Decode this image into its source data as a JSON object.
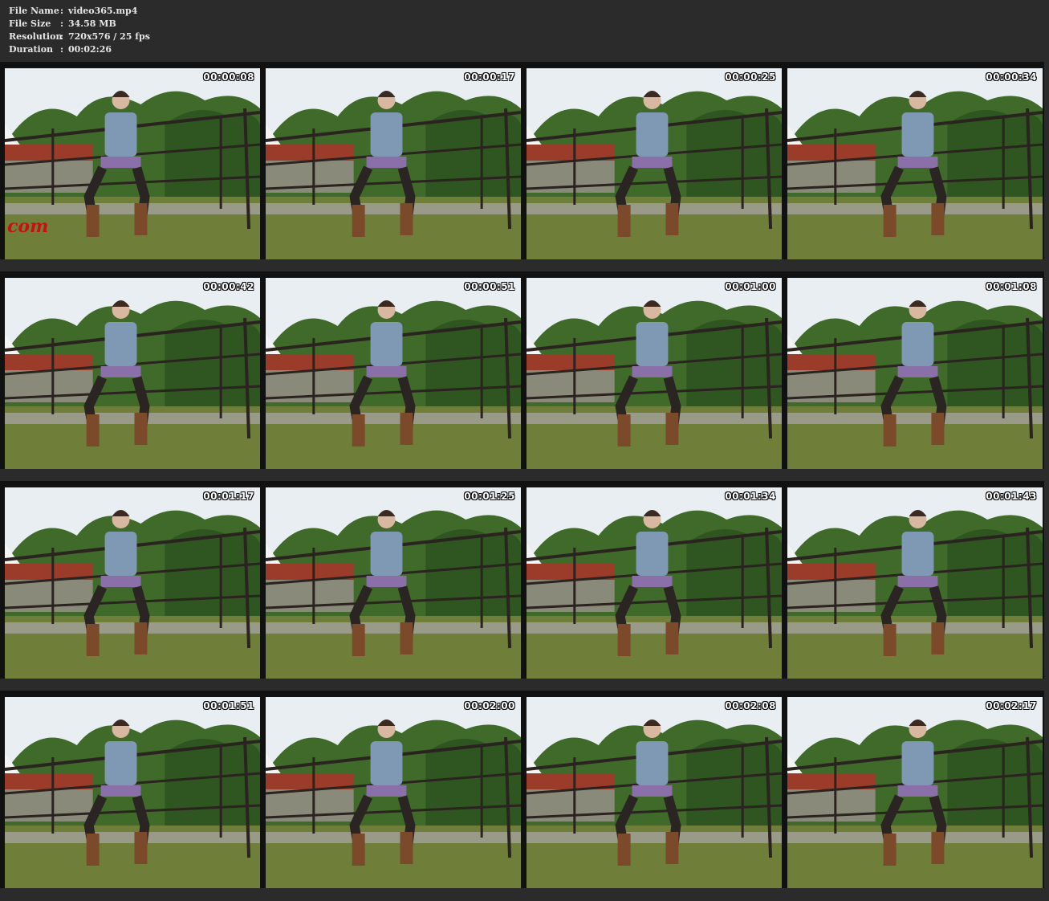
{
  "header": {
    "rows": [
      {
        "label": "File Name",
        "sep": ":",
        "value": "video365.mp4"
      },
      {
        "label": "File Size",
        "sep": ":",
        "value": "34.58 MB"
      },
      {
        "label": "Resolution",
        "sep": ":",
        "value": "720x576 / 25 fps"
      },
      {
        "label": "Duration",
        "sep": ":",
        "value": "00:02:26"
      }
    ]
  },
  "watermark": "com",
  "thumbnails": [
    {
      "timestamp": "00:00:08"
    },
    {
      "timestamp": "00:00:17"
    },
    {
      "timestamp": "00:00:25"
    },
    {
      "timestamp": "00:00:34"
    },
    {
      "timestamp": "00:00:42"
    },
    {
      "timestamp": "00:00:51"
    },
    {
      "timestamp": "00:01:00"
    },
    {
      "timestamp": "00:01:08"
    },
    {
      "timestamp": "00:01:17"
    },
    {
      "timestamp": "00:01:25"
    },
    {
      "timestamp": "00:01:34"
    },
    {
      "timestamp": "00:01:43"
    },
    {
      "timestamp": "00:01:51"
    },
    {
      "timestamp": "00:02:00"
    },
    {
      "timestamp": "00:02:08"
    },
    {
      "timestamp": "00:02:17"
    }
  ],
  "colors": {
    "background": "#2b2b2b",
    "sky": "#e8eef2",
    "foliage": "#3f6a2a",
    "grass": "#6f7f3a",
    "rail": "#2a2320",
    "roof": "#9b3b2a",
    "denim": "#7f98b4",
    "boots": "#7a4a2a"
  }
}
